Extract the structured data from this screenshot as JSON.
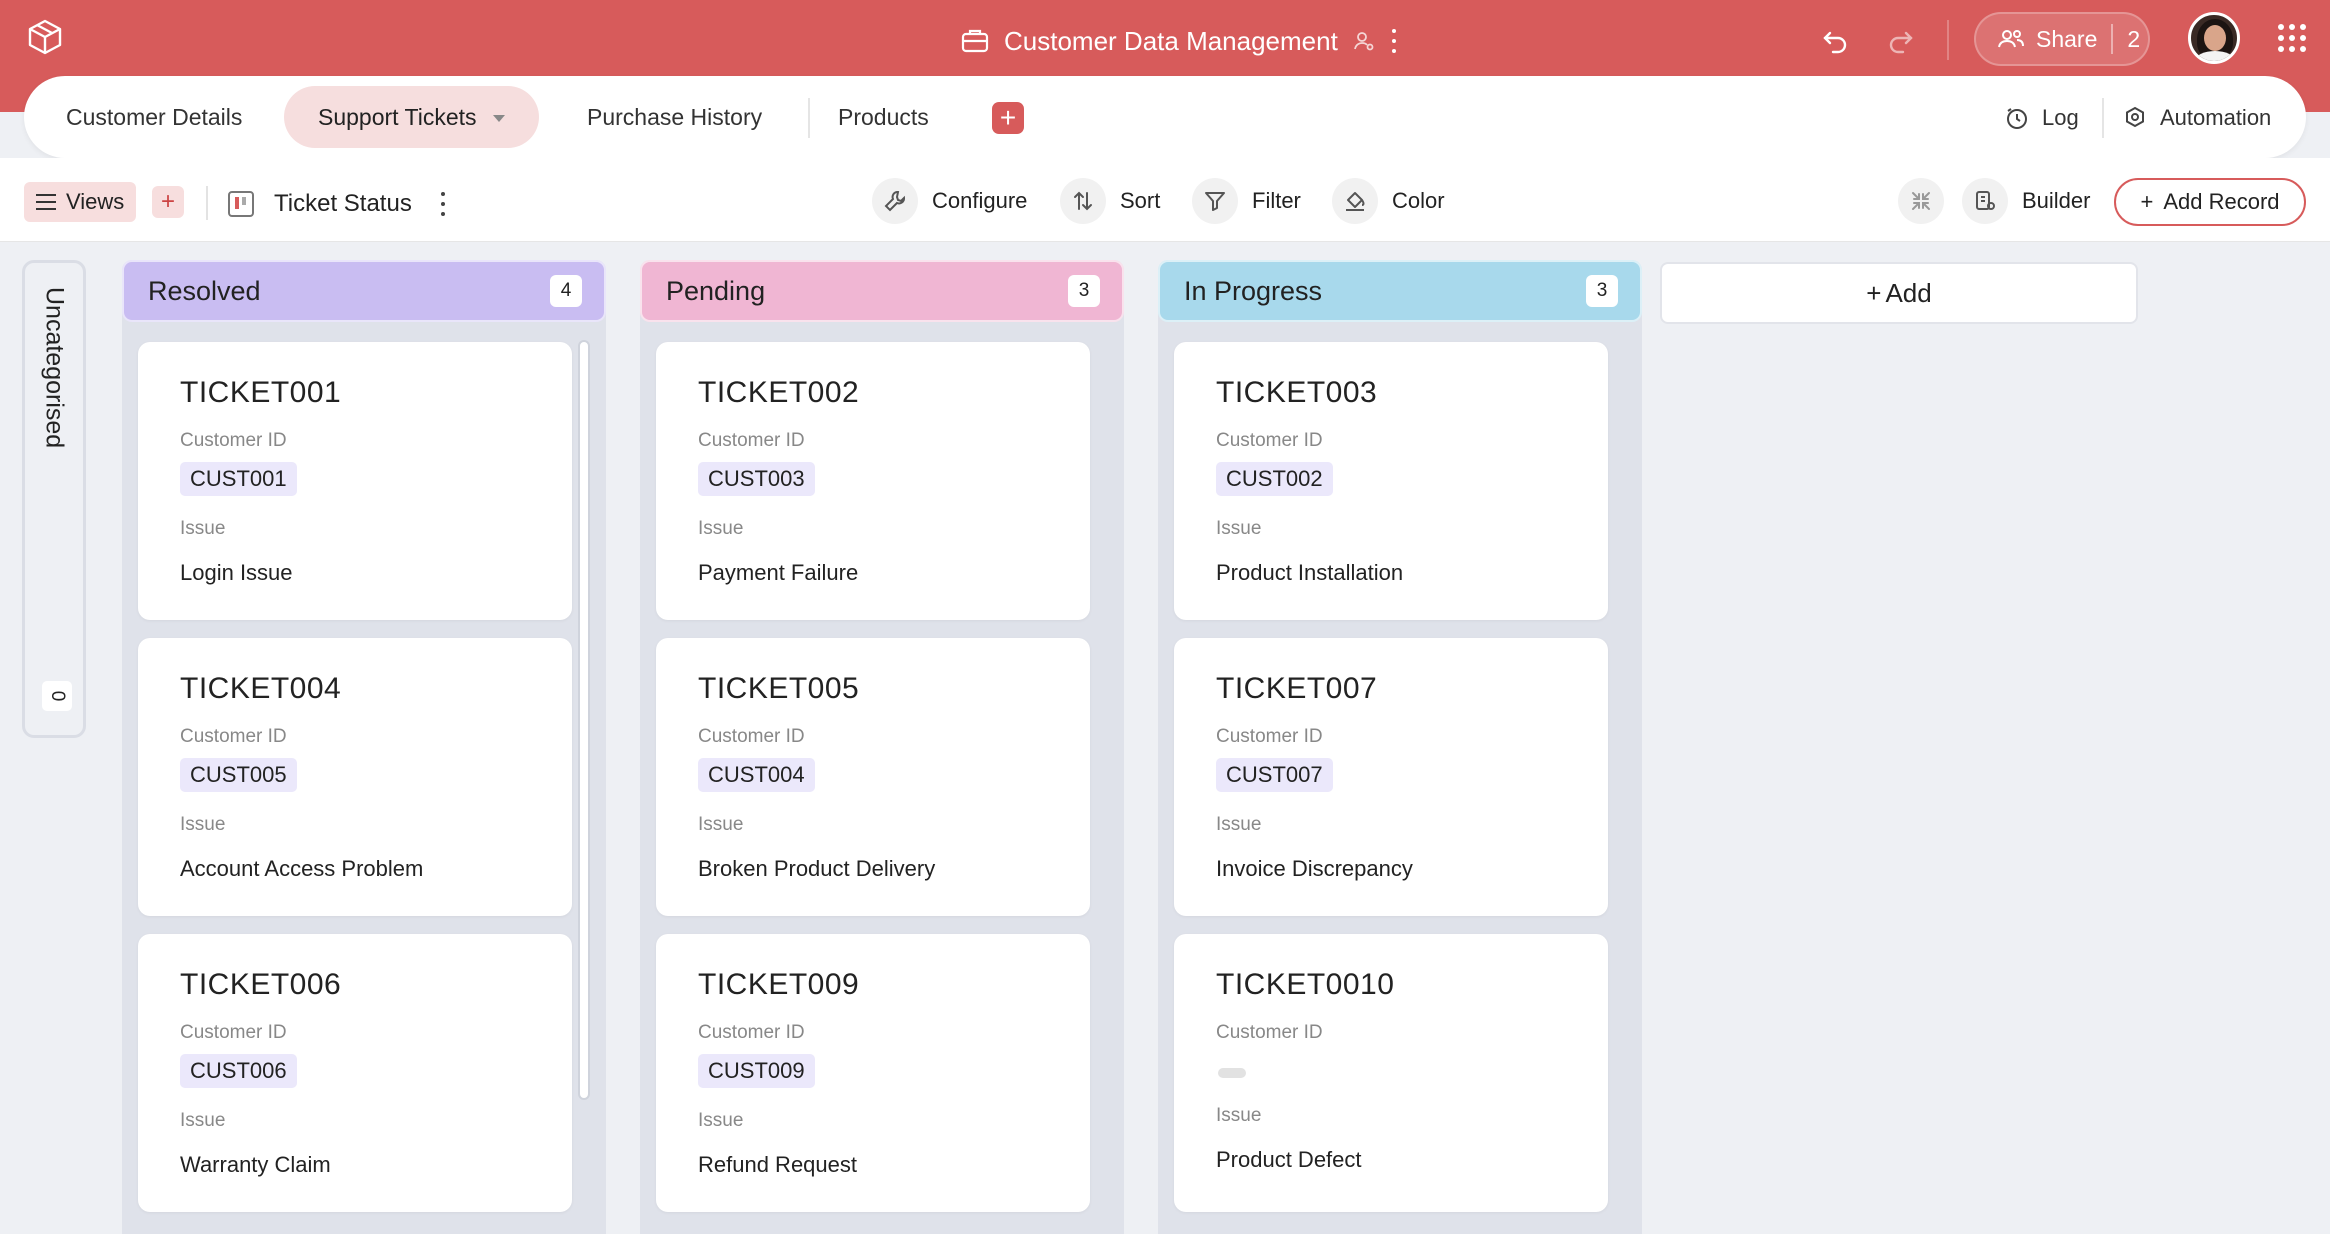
{
  "header": {
    "title": "Customer Data Management",
    "share_label": "Share",
    "share_count": "2"
  },
  "tabs": [
    {
      "label": "Customer Details"
    },
    {
      "label": "Support Tickets"
    },
    {
      "label": "Purchase History"
    },
    {
      "label": "Products"
    }
  ],
  "tabs_right": {
    "log_label": "Log",
    "automation_label": "Automation"
  },
  "toolbar": {
    "views_label": "Views",
    "view_name": "Ticket Status",
    "configure_label": "Configure",
    "sort_label": "Sort",
    "filter_label": "Filter",
    "color_label": "Color",
    "builder_label": "Builder",
    "add_record_label": "Add Record"
  },
  "board": {
    "uncategorised": {
      "label": "Uncategorised",
      "count": "0"
    },
    "add_column_label": "Add",
    "field_labels": {
      "customer_id": "Customer ID",
      "issue": "Issue"
    },
    "columns": [
      {
        "name": "Resolved",
        "count": "4",
        "color": "#c9bdf2",
        "cards": [
          {
            "id": "TICKET001",
            "customer_id": "CUST001",
            "issue": "Login Issue"
          },
          {
            "id": "TICKET004",
            "customer_id": "CUST005",
            "issue": "Account Access Problem"
          },
          {
            "id": "TICKET006",
            "customer_id": "CUST006",
            "issue": "Warranty Claim"
          }
        ]
      },
      {
        "name": "Pending",
        "count": "3",
        "color": "#f0b6d3",
        "cards": [
          {
            "id": "TICKET002",
            "customer_id": "CUST003",
            "issue": "Payment Failure"
          },
          {
            "id": "TICKET005",
            "customer_id": "CUST004",
            "issue": "Broken Product Delivery"
          },
          {
            "id": "TICKET009",
            "customer_id": "CUST009",
            "issue": "Refund Request"
          }
        ]
      },
      {
        "name": "In Progress",
        "count": "3",
        "color": "#a8d9ec",
        "cards": [
          {
            "id": "TICKET003",
            "customer_id": "CUST002",
            "issue": "Product Installation"
          },
          {
            "id": "TICKET007",
            "customer_id": "CUST007",
            "issue": "Invoice Discrepancy"
          },
          {
            "id": "TICKET0010",
            "customer_id": "",
            "issue": "Product Defect"
          }
        ]
      }
    ]
  },
  "colors": {
    "brand": "#d75b5b",
    "chip_bg": "#ebe8fb"
  }
}
